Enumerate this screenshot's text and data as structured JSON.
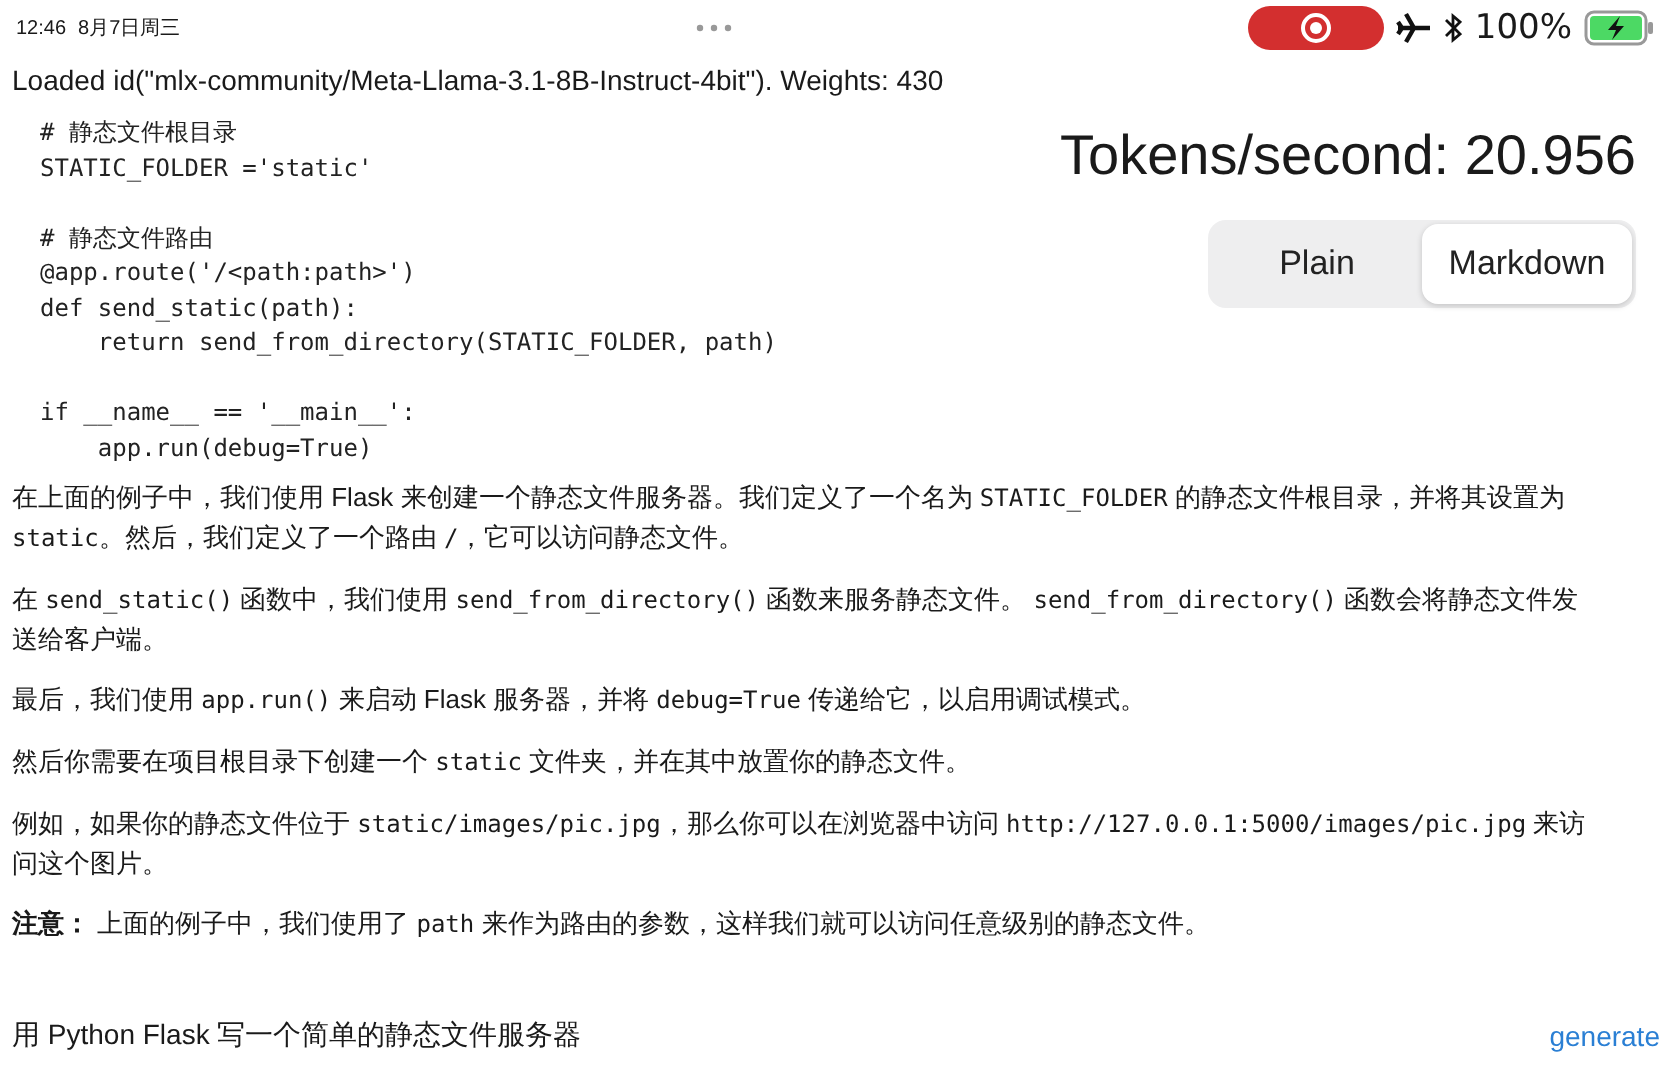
{
  "status_bar": {
    "time": "12:46",
    "date": "8月7日周三",
    "battery": "100%",
    "recording": true,
    "charging": true
  },
  "model_status": "Loaded id(\"mlx-community/Meta-Llama-3.1-8B-Instruct-4bit\").  Weights: 430",
  "tokens_per_second": "Tokens/second: 20.956",
  "display_mode": [
    {
      "label": "Plain",
      "selected": false
    },
    {
      "label": "Markdown",
      "selected": true
    }
  ],
  "code_blocks": [
    [
      "# 静态文件根目录",
      "STATIC_FOLDER ='static'"
    ],
    [
      "# 静态文件路由",
      "@app.route('/<path:path>')",
      "def send_static(path):",
      "    return send_from_directory(STATIC_FOLDER, path)"
    ],
    [
      "if __name__ == '__main__':",
      "    app.run(debug=True)"
    ]
  ],
  "paragraphs": [
    [
      {
        "kind": "text",
        "text": "在上面的例子中，我们使用 Flask 来创建一个静态文件服务器。我们定义了一个名为 "
      },
      {
        "kind": "code",
        "text": "STATIC_FOLDER"
      },
      {
        "kind": "text",
        "text": " 的静态文件根目录，并将其设置为 "
      },
      {
        "kind": "code",
        "text": "static"
      },
      {
        "kind": "text",
        "text": "。然后，我们定义了一个路由 "
      },
      {
        "kind": "code",
        "text": "/"
      },
      {
        "kind": "text",
        "text": "，它可以访问静态文件。"
      }
    ],
    [
      {
        "kind": "text",
        "text": "在 "
      },
      {
        "kind": "code",
        "text": "send_static()"
      },
      {
        "kind": "text",
        "text": " 函数中，我们使用 "
      },
      {
        "kind": "code",
        "text": "send_from_directory()"
      },
      {
        "kind": "text",
        "text": " 函数来服务静态文件。 "
      },
      {
        "kind": "code",
        "text": "send_from_directory()"
      },
      {
        "kind": "text",
        "text": " 函数会将静态文件发送给客户端。"
      }
    ],
    [
      {
        "kind": "text",
        "text": "最后，我们使用 "
      },
      {
        "kind": "code",
        "text": "app.run()"
      },
      {
        "kind": "text",
        "text": " 来启动 Flask 服务器，并将 "
      },
      {
        "kind": "code",
        "text": "debug=True"
      },
      {
        "kind": "text",
        "text": " 传递给它，以启用调试模式。"
      }
    ],
    [
      {
        "kind": "text",
        "text": "然后你需要在项目根目录下创建一个 "
      },
      {
        "kind": "code",
        "text": "static"
      },
      {
        "kind": "text",
        "text": " 文件夹，并在其中放置你的静态文件。"
      }
    ],
    [
      {
        "kind": "text",
        "text": "例如，如果你的静态文件位于 "
      },
      {
        "kind": "code",
        "text": "static/images/pic.jpg"
      },
      {
        "kind": "text",
        "text": "，那么你可以在浏览器中访问 "
      },
      {
        "kind": "code",
        "text": "http://127.0.0.1:5000/images/pic.jpg"
      },
      {
        "kind": "text",
        "text": " 来访问这个图片。"
      }
    ],
    [
      {
        "kind": "bold",
        "text": "注意："
      },
      {
        "kind": "text",
        "text": " 上面的例子中，我们使用了 "
      },
      {
        "kind": "code",
        "text": "path"
      },
      {
        "kind": "text",
        "text": " 来作为路由的参数，这样我们就可以访问任意级别的静态文件。"
      }
    ]
  ],
  "prompt": {
    "value": "用 Python Flask 写一个简单的静态文件服务器"
  },
  "generate_button": "generate"
}
